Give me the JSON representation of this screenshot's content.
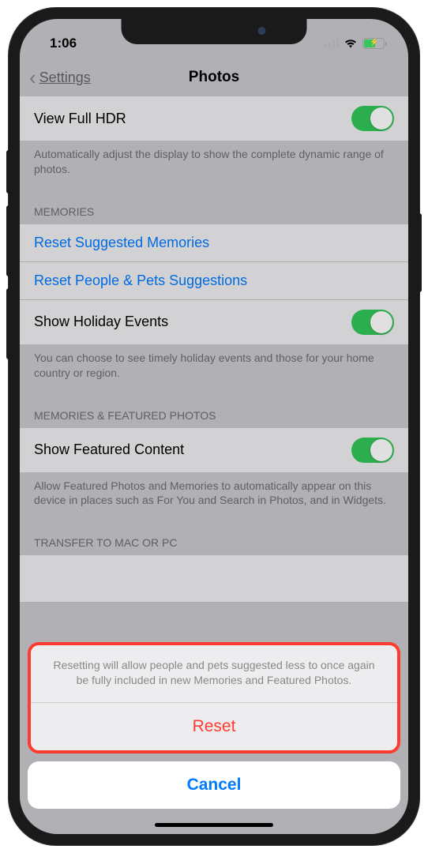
{
  "status": {
    "time": "1:06"
  },
  "nav": {
    "back_label": "Settings",
    "title": "Photos"
  },
  "hdr": {
    "title": "View Full HDR",
    "footer": "Automatically adjust the display to show the complete dynamic range of photos."
  },
  "memories": {
    "header": "MEMORIES",
    "reset_suggested": "Reset Suggested Memories",
    "reset_people_pets": "Reset People & Pets Suggestions",
    "holiday_events": "Show Holiday Events",
    "footer": "You can choose to see timely holiday events and those for your home country or region."
  },
  "featured": {
    "header": "MEMORIES & FEATURED PHOTOS",
    "show_content": "Show Featured Content",
    "footer": "Allow Featured Photos and Memories to automatically appear on this device in places such as For You and Search in Photos, and in Widgets."
  },
  "transfer": {
    "header": "TRANSFER TO MAC OR PC"
  },
  "sheet": {
    "message": "Resetting will allow people and pets suggested less to once again be fully included in new Memories and Featured Photos.",
    "reset_label": "Reset",
    "cancel_label": "Cancel"
  }
}
